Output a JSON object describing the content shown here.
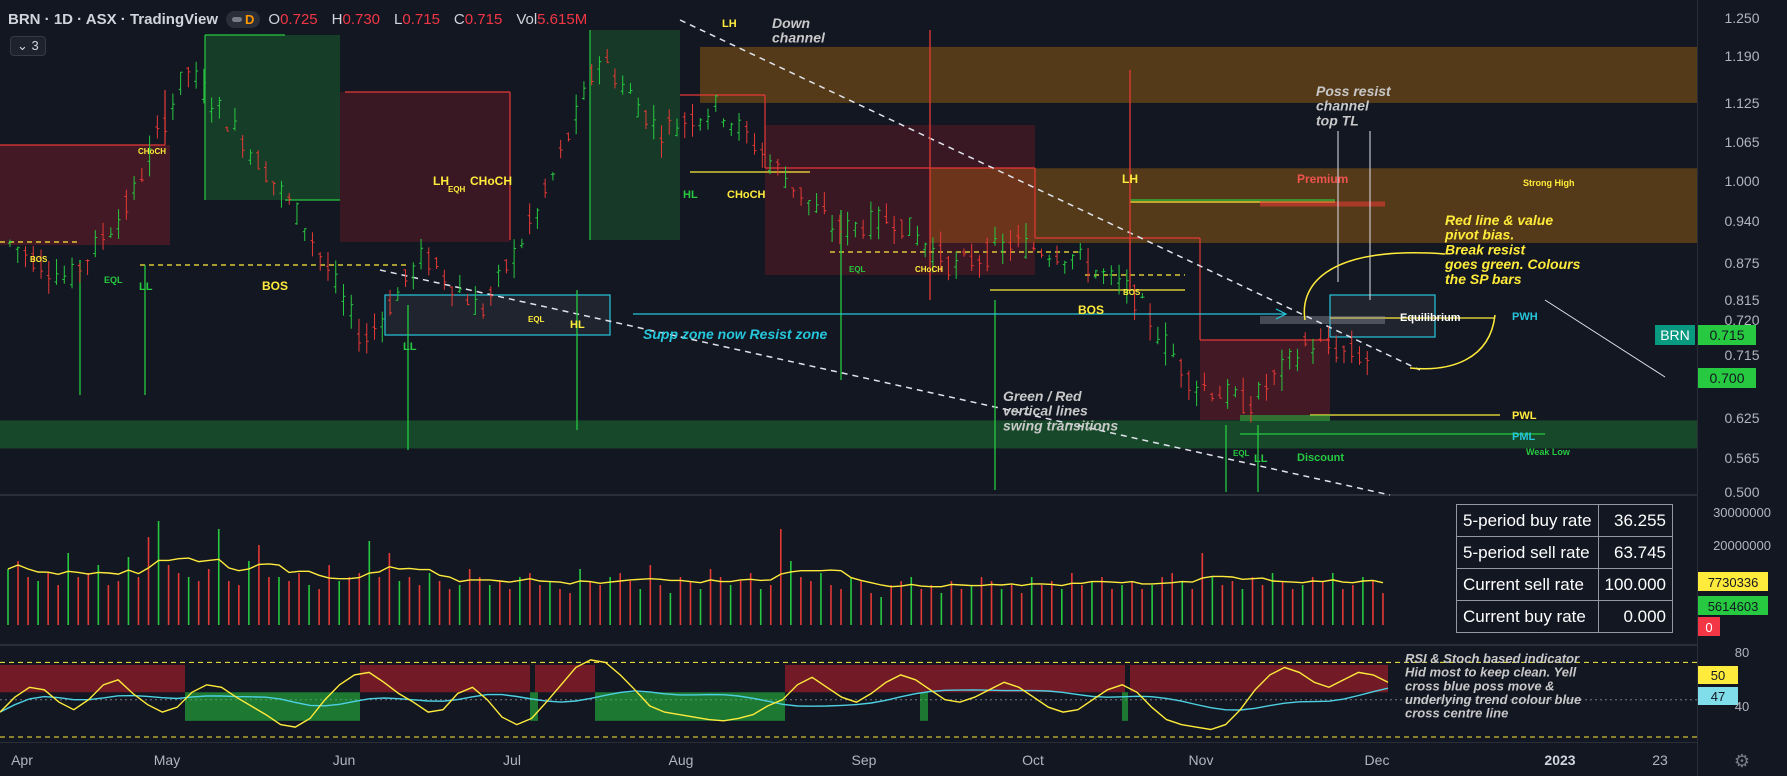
{
  "header": {
    "symbol": "BRN · 1D · ASX · TradingView",
    "mode": "D",
    "o_label": "O",
    "o": "0.725",
    "h_label": "H",
    "h": "0.730",
    "l_label": "L",
    "l": "0.715",
    "c_label": "C",
    "c": "0.715",
    "vol_label": "Vol",
    "vol": "5.615M"
  },
  "indicator_count": "3",
  "stats_table": [
    {
      "label": "5-period buy rate",
      "value": "36.255"
    },
    {
      "label": "5-period sell rate",
      "value": "63.745"
    },
    {
      "label": "Current sell rate",
      "value": "100.000"
    },
    {
      "label": "Current buy rate",
      "value": "0.000"
    }
  ],
  "colors": {
    "background": "#131722",
    "up": "#26c940",
    "down": "#d1202c",
    "annotation_yellow": "#ffeb3b",
    "annotation_cyan": "#26c6da",
    "annotation_gray": "#c8c8c8"
  },
  "chart_data": [
    {
      "type": "price",
      "symbol": "BRN",
      "y_ticks": [
        "1.250",
        "1.190",
        "1.125",
        "1.065",
        "1.000",
        "0.940",
        "0.875",
        "0.815",
        "0.720",
        "0.715",
        "0.625",
        "0.565",
        "0.500"
      ],
      "x_ticks": [
        "Apr",
        "May",
        "Jun",
        "Jul",
        "Aug",
        "Sep",
        "Oct",
        "Nov",
        "Dec",
        "2023",
        "23"
      ],
      "price_badges": [
        {
          "label": "BRN",
          "value": "0.715"
        },
        {
          "label": "",
          "value": "0.700"
        }
      ],
      "series": [
        {
          "x": "2022-04-01",
          "o": 0.93,
          "h": 0.96,
          "l": 0.88,
          "c": 0.9
        },
        {
          "x": "2022-04-15",
          "o": 0.9,
          "h": 0.92,
          "l": 0.8,
          "c": 0.84
        },
        {
          "x": "2022-05-01",
          "o": 0.84,
          "h": 0.98,
          "l": 0.82,
          "c": 0.96
        },
        {
          "x": "2022-05-15",
          "o": 0.96,
          "h": 1.22,
          "l": 0.94,
          "c": 1.18
        },
        {
          "x": "2022-05-25",
          "o": 1.18,
          "h": 1.28,
          "l": 1.02,
          "c": 1.06
        },
        {
          "x": "2022-06-05",
          "o": 1.06,
          "h": 1.1,
          "l": 0.9,
          "c": 0.93
        },
        {
          "x": "2022-06-15",
          "o": 0.93,
          "h": 0.95,
          "l": 0.68,
          "c": 0.74
        },
        {
          "x": "2022-06-25",
          "o": 0.74,
          "h": 0.92,
          "l": 0.72,
          "c": 0.88
        },
        {
          "x": "2022-07-05",
          "o": 0.88,
          "h": 0.92,
          "l": 0.76,
          "c": 0.79
        },
        {
          "x": "2022-07-15",
          "o": 0.79,
          "h": 0.98,
          "l": 0.68,
          "c": 0.96
        },
        {
          "x": "2022-07-25",
          "o": 0.96,
          "h": 1.22,
          "l": 0.94,
          "c": 1.2
        },
        {
          "x": "2022-08-01",
          "o": 1.2,
          "h": 1.32,
          "l": 1.04,
          "c": 1.08
        },
        {
          "x": "2022-08-10",
          "o": 1.08,
          "h": 1.16,
          "l": 1.02,
          "c": 1.12
        },
        {
          "x": "2022-08-20",
          "o": 1.12,
          "h": 1.14,
          "l": 1.0,
          "c": 1.02
        },
        {
          "x": "2022-09-01",
          "o": 1.02,
          "h": 1.04,
          "l": 0.9,
          "c": 0.92
        },
        {
          "x": "2022-09-12",
          "o": 0.92,
          "h": 1.22,
          "l": 0.86,
          "c": 0.94
        },
        {
          "x": "2022-09-25",
          "o": 0.94,
          "h": 0.98,
          "l": 0.82,
          "c": 0.86
        },
        {
          "x": "2022-10-05",
          "o": 0.86,
          "h": 0.94,
          "l": 0.84,
          "c": 0.9
        },
        {
          "x": "2022-10-15",
          "o": 0.9,
          "h": 1.16,
          "l": 0.84,
          "c": 0.88
        },
        {
          "x": "2022-10-25",
          "o": 0.88,
          "h": 0.9,
          "l": 0.8,
          "c": 0.82
        },
        {
          "x": "2022-11-01",
          "o": 0.82,
          "h": 0.83,
          "l": 0.66,
          "c": 0.68
        },
        {
          "x": "2022-11-10",
          "o": 0.68,
          "h": 0.7,
          "l": 0.57,
          "c": 0.64
        },
        {
          "x": "2022-11-20",
          "o": 0.64,
          "h": 0.76,
          "l": 0.62,
          "c": 0.74
        },
        {
          "x": "2022-12-01",
          "o": 0.725,
          "h": 0.73,
          "l": 0.7,
          "c": 0.715
        }
      ],
      "zones": [
        {
          "from": 1.125,
          "to": 1.215
        },
        {
          "from": 0.9,
          "to": 1.02
        },
        {
          "from": 0.57,
          "to": 0.615
        }
      ],
      "annotations": [
        "LH",
        "Down channel",
        "CHoCH",
        "LH",
        "EQH",
        "CHoCH",
        "HL",
        "CHoCH",
        "BOS",
        "EQL",
        "LL",
        "BOS",
        "EQL",
        "HL",
        "LL",
        "Supp zone now Resist zone",
        "EQL",
        "CHoCH",
        "BOS",
        "BOS",
        "LH",
        "Premium",
        "Strong High",
        "Poss resist channel top TL",
        "Red line & value pivot bias. Break resist goes green. Colours the SP bars",
        "Equilibrium",
        "PWH",
        "PWL",
        "PML",
        "Weak Low",
        "EQL",
        "LL",
        "Discount",
        "Green / Red vertical lines swing transitions"
      ]
    },
    {
      "type": "bar",
      "name": "Volume",
      "y_ticks": [
        "30000000",
        "20000000"
      ],
      "badges": [
        "7730336",
        "5614603",
        "0"
      ],
      "values": [
        14,
        16,
        12,
        11,
        13,
        10,
        18,
        12,
        13,
        15,
        10,
        11,
        17,
        12,
        22,
        26,
        15,
        13,
        12,
        11,
        14,
        24,
        11,
        10,
        16,
        20,
        12,
        12,
        11,
        13,
        10,
        9,
        15,
        11,
        12,
        13,
        21,
        12,
        18,
        11,
        12,
        10,
        13,
        11,
        9,
        10,
        14,
        12,
        10,
        11,
        9,
        12,
        13,
        10,
        11,
        9,
        8,
        14,
        11,
        10,
        12,
        13,
        11,
        9,
        15,
        10,
        8,
        12,
        11,
        9,
        14,
        12,
        10,
        11,
        13,
        9,
        10,
        24,
        16,
        12,
        11,
        13,
        10,
        9,
        12,
        11,
        8,
        7,
        10,
        11,
        12,
        9,
        10,
        8,
        11,
        9,
        10,
        12,
        11,
        9,
        10,
        8,
        12,
        10,
        11,
        9,
        13,
        10,
        11,
        12,
        9,
        10,
        11,
        9,
        10,
        12,
        13,
        11,
        9,
        18,
        12,
        10,
        11,
        9,
        12,
        10,
        13,
        11,
        9,
        10,
        12,
        11,
        13,
        9,
        10,
        12,
        11,
        8
      ]
    },
    {
      "type": "line",
      "name": "RSI & Stoch",
      "y_ticks": [
        "80",
        "50",
        "47",
        "40"
      ],
      "annotation": "RSI & Stoch based indicator Hid most to keep clean. Yell cross blue poss move & underlying trend colour blue cross centre line",
      "values": [
        40,
        52,
        60,
        58,
        48,
        42,
        50,
        62,
        66,
        55,
        46,
        40,
        44,
        56,
        62,
        60,
        52,
        45,
        38,
        30,
        28,
        35,
        50,
        62,
        70,
        72,
        64,
        55,
        48,
        40,
        42,
        55,
        60,
        50,
        36,
        30,
        35,
        48,
        62,
        76,
        82,
        80,
        70,
        58,
        45,
        40,
        38,
        36,
        34,
        33,
        35,
        38,
        45,
        50,
        62,
        68,
        60,
        52,
        48,
        55,
        64,
        70,
        66,
        58,
        50,
        48,
        52,
        58,
        64,
        60,
        52,
        44,
        40,
        42,
        50,
        58,
        62,
        56,
        44,
        34,
        30,
        28,
        26,
        30,
        42,
        58,
        70,
        76,
        72,
        64,
        60,
        66,
        72,
        70,
        64
      ]
    }
  ]
}
